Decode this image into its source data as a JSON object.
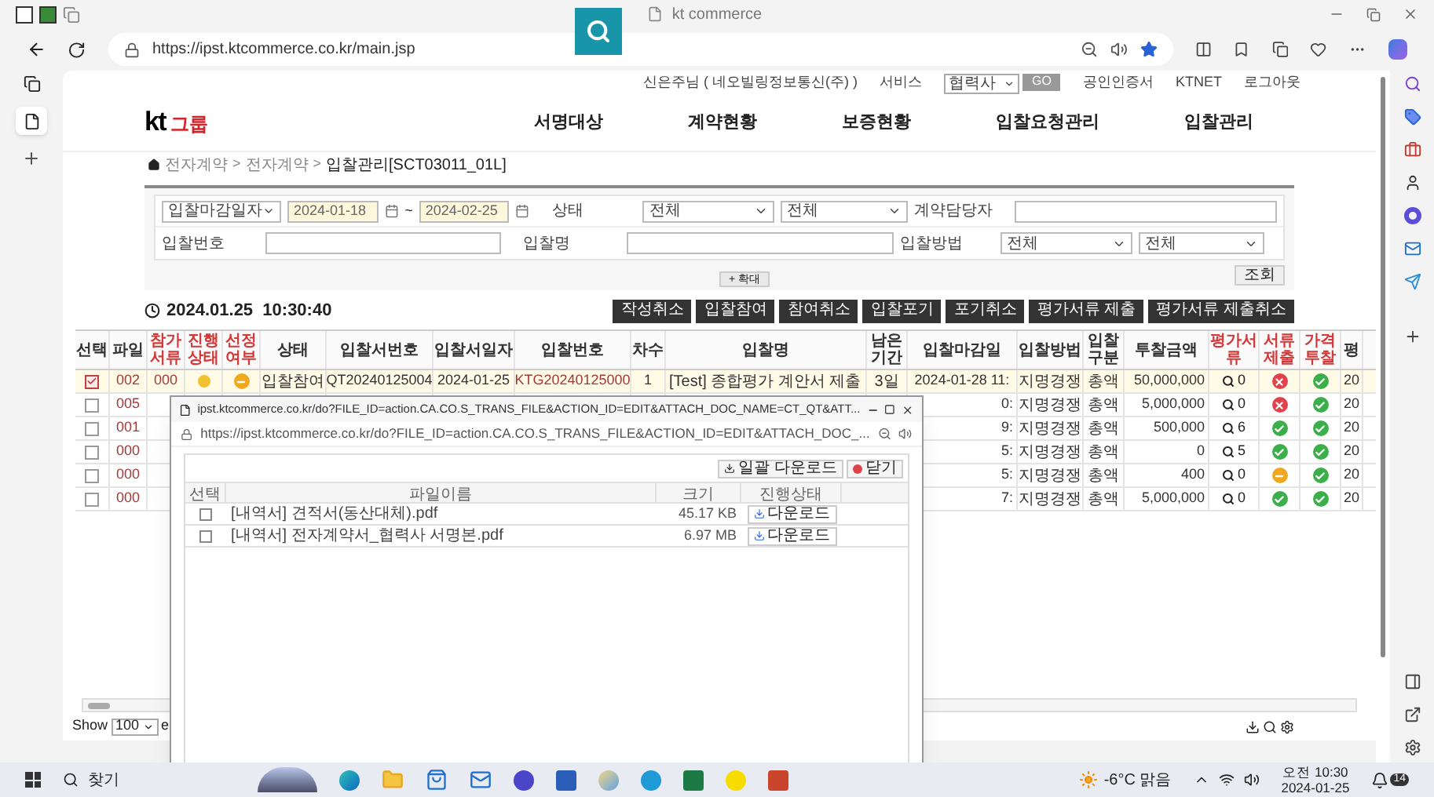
{
  "browser": {
    "tab_title": "kt commerce",
    "url": "https://ipst.ktcommerce.co.kr/main.jsp"
  },
  "utility_bar": {
    "user": "신은주님 ( 네오빌링정보통신(주) )",
    "service": "서비스",
    "company_select": "협력사",
    "go": "GO",
    "cert": "공인인증서",
    "ktnet": "KTNET",
    "logout": "로그아웃"
  },
  "logo": {
    "mark": "kt",
    "text": "그룹"
  },
  "nav": [
    "서명대상",
    "계약현황",
    "보증현황",
    "입찰요청관리",
    "입찰관리"
  ],
  "breadcrumb": [
    "전자계약",
    ">",
    "전자계약",
    ">",
    "입찰관리[SCT03011_01L]"
  ],
  "filters": {
    "date_type": "입찰마감일자",
    "date_from": "2024-01-18",
    "date_sep": "~",
    "date_to": "2024-02-25",
    "status_label": "상태",
    "status_values": [
      "전체",
      "전체"
    ],
    "manager_label": "계약담당자",
    "bid_no_label": "입찰번호",
    "bid_name_label": "입찰명",
    "method_label": "입찰방법",
    "method_values": [
      "전체",
      "전체"
    ],
    "expand": "+ 확대",
    "search": "조회"
  },
  "clock": "2024.01.25  10:30:40",
  "actions": [
    "작성취소",
    "입찰참여",
    "참여취소",
    "입찰포기",
    "포기취소",
    "평가서류 제출",
    "평가서류 제출취소"
  ],
  "table": {
    "columns": [
      {
        "label": "선택",
        "emphasized": false
      },
      {
        "label": "파일",
        "emphasized": false
      },
      {
        "label": "참가서류",
        "emphasized": true
      },
      {
        "label": "진행상태",
        "emphasized": true
      },
      {
        "label": "선정여부",
        "emphasized": true
      },
      {
        "label": "상태",
        "emphasized": false
      },
      {
        "label": "입찰서번호",
        "emphasized": false
      },
      {
        "label": "입찰서일자",
        "emphasized": false
      },
      {
        "label": "입찰번호",
        "emphasized": false
      },
      {
        "label": "차수",
        "emphasized": false
      },
      {
        "label": "입찰명",
        "emphasized": false
      },
      {
        "label": "남은기간",
        "emphasized": false
      },
      {
        "label": "입찰마감일",
        "emphasized": false
      },
      {
        "label": "입찰방법",
        "emphasized": false
      },
      {
        "label": "입찰구분",
        "emphasized": false
      },
      {
        "label": "투찰금액",
        "emphasized": false
      },
      {
        "label": "평가서류",
        "emphasized": true
      },
      {
        "label": "서류제출",
        "emphasized": true
      },
      {
        "label": "가격투찰",
        "emphasized": true
      },
      {
        "label": "평",
        "emphasized": false
      }
    ],
    "rows": [
      {
        "checked": true,
        "file": "002",
        "docs": "000",
        "progress_dot": true,
        "selection": {
          "kind": "pending"
        },
        "status": "입찰참여",
        "bid_doc_no": "QT20240125004",
        "bid_doc_date": "2024-01-25",
        "bid_no": "KTG20240125000",
        "round": "1",
        "name": "[Test] 종합평가 계안서 제출",
        "remaining": "3일",
        "deadline": "2024-01-28 11:",
        "method": "지명경쟁",
        "type": "총액",
        "amount": "50,000,000",
        "eval_count": "0",
        "doc_submit": {
          "kind": "rejected"
        },
        "price_bid": {
          "kind": "done"
        },
        "column_20": "20"
      },
      {
        "checked": false,
        "file": "005",
        "deadline": "0:",
        "method": "지명경쟁",
        "type": "총액",
        "amount": "5,000,000",
        "eval_count": "0",
        "doc_submit": {
          "kind": "rejected"
        },
        "price_bid": {
          "kind": "done"
        },
        "column_20": "20"
      },
      {
        "checked": false,
        "file": "001",
        "deadline": "9:",
        "method": "지명경쟁",
        "type": "총액",
        "amount": "500,000",
        "eval_count": "6",
        "doc_submit": {
          "kind": "done"
        },
        "price_bid": {
          "kind": "done"
        },
        "column_20": "20"
      },
      {
        "checked": false,
        "file": "000",
        "deadline": "5:",
        "method": "지명경쟁",
        "type": "총액",
        "amount": "0",
        "eval_count": "5",
        "doc_submit": {
          "kind": "done"
        },
        "price_bid": {
          "kind": "done"
        },
        "column_20": "20"
      },
      {
        "checked": false,
        "file": "000",
        "deadline": "5:",
        "method": "지명경쟁",
        "type": "총액",
        "amount": "400",
        "eval_count": "0",
        "doc_submit": {
          "kind": "pending"
        },
        "price_bid": {
          "kind": "done"
        },
        "column_20": "20"
      },
      {
        "checked": false,
        "file": "000",
        "deadline": "7:",
        "method": "지명경쟁",
        "type": "총액",
        "amount": "5,000,000",
        "eval_count": "0",
        "doc_submit": {
          "kind": "done"
        },
        "price_bid": {
          "kind": "done"
        },
        "column_20": "20"
      }
    ]
  },
  "table_footer": {
    "show_label": "Show",
    "page_size": "100",
    "trail": "e"
  },
  "popup": {
    "title": "ipst.ktcommerce.co.kr/do?FILE_ID=action.CA.CO.S_TRANS_FILE&ACTION_ID=EDIT&ATTACH_DOC_NAME=CT_QT&ATT...",
    "url": "https://ipst.ktcommerce.co.kr/do?FILE_ID=action.CA.CO.S_TRANS_FILE&ACTION_ID=EDIT&ATTACH_DOC_...",
    "bulk_download": "일괄 다운로드",
    "close": "닫기",
    "columns": [
      "선택",
      "파일이름",
      "크기",
      "진행상태"
    ],
    "rows": [
      {
        "checked": false,
        "name": "[내역서] 견적서(동산대체).pdf",
        "size": "45.17 KB",
        "action": "다운로드"
      },
      {
        "checked": false,
        "name": "[내역서] 전자계약서_협력사 서명본.pdf",
        "size": "6.97 MB",
        "action": "다운로드"
      }
    ]
  },
  "taskbar": {
    "search": "찾기",
    "weather": "-6°C 맑음",
    "time": "오전 10:30",
    "date": "2024-01-25",
    "notifications": "14"
  }
}
